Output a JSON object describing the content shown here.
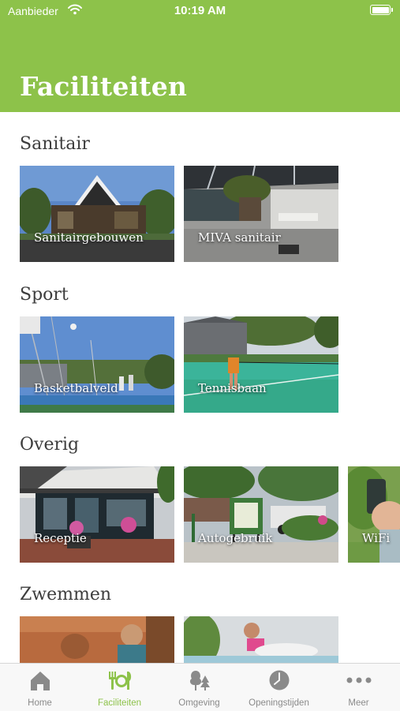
{
  "status_bar": {
    "carrier": "Aanbieder",
    "time": "10:19 AM"
  },
  "header": {
    "title": "Faciliteiten"
  },
  "sections": [
    {
      "title": "Sanitair",
      "items": [
        {
          "label": "Sanitairgebouwen"
        },
        {
          "label": "MIVA sanitair"
        }
      ]
    },
    {
      "title": "Sport",
      "items": [
        {
          "label": "Basketbalveld"
        },
        {
          "label": "Tennisbaan"
        }
      ]
    },
    {
      "title": "Overig",
      "items": [
        {
          "label": "Receptie"
        },
        {
          "label": "Autogebruik"
        },
        {
          "label": "WiFi"
        }
      ]
    },
    {
      "title": "Zwemmen",
      "items": []
    }
  ],
  "tabbar": {
    "active_color": "#8dc24a",
    "inactive_color": "#8a8a8a",
    "tabs": [
      {
        "label": "Home",
        "icon": "home-icon"
      },
      {
        "label": "Faciliteiten",
        "icon": "cutlery-icon",
        "active": true
      },
      {
        "label": "Omgeving",
        "icon": "trees-icon"
      },
      {
        "label": "Openingstijden",
        "icon": "clock-icon"
      },
      {
        "label": "Meer",
        "icon": "more-icon"
      }
    ]
  },
  "colors": {
    "brand": "#8dc24a",
    "background": "#ffffff",
    "section_title": "#3d3d3d"
  }
}
